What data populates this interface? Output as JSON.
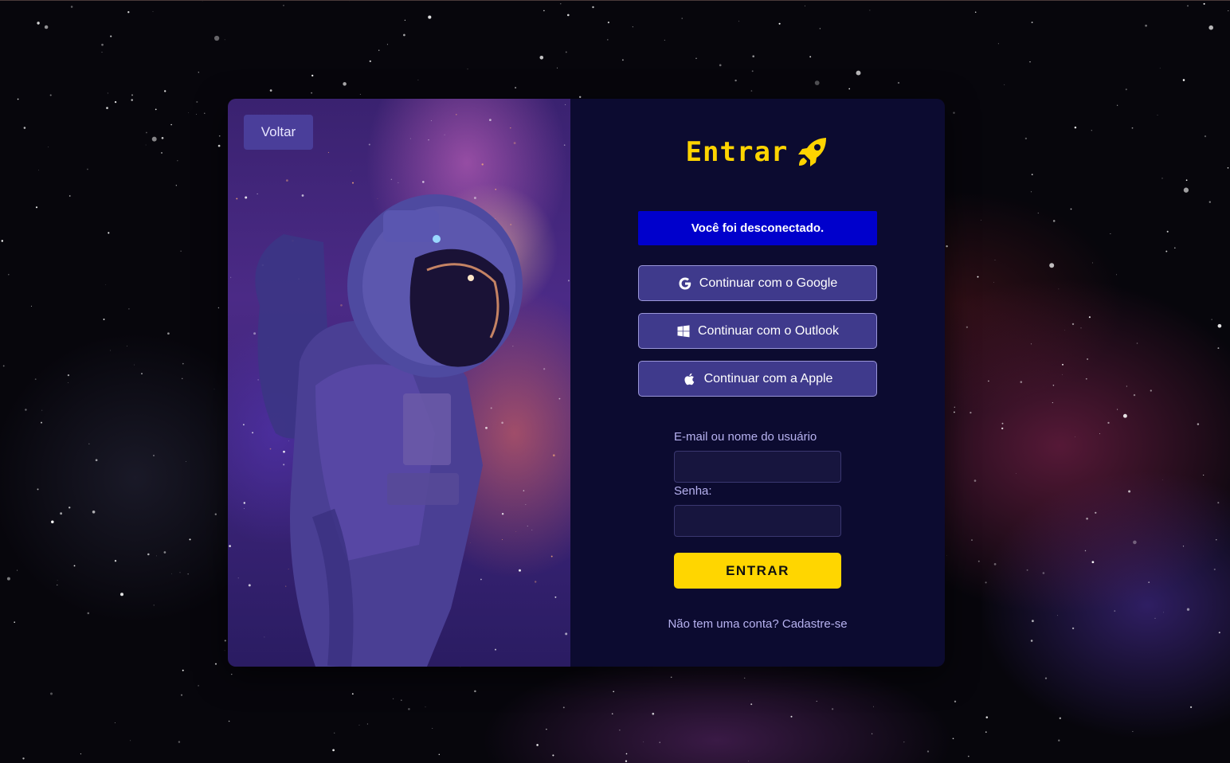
{
  "back_button": {
    "label": "Voltar"
  },
  "header": {
    "title": "Entrar",
    "icon": "rocket-icon",
    "accent": "#ffd400"
  },
  "alert": {
    "message": "Você foi desconectado.",
    "color": "#0000cc"
  },
  "sso": [
    {
      "label": "Continuar com o Google",
      "icon": "google-icon"
    },
    {
      "label": "Continuar com o Outlook",
      "icon": "windows-icon"
    },
    {
      "label": "Continuar com a Apple",
      "icon": "apple-icon"
    }
  ],
  "form": {
    "email_label": "E-mail ou nome do usuário",
    "email_value": "",
    "password_label": "Senha:",
    "password_value": "",
    "submit_label": "ENTRAR",
    "submit_color": "#ffd600"
  },
  "footer": {
    "prompt": "Não tem uma conta?",
    "link": "Cadastre-se"
  }
}
